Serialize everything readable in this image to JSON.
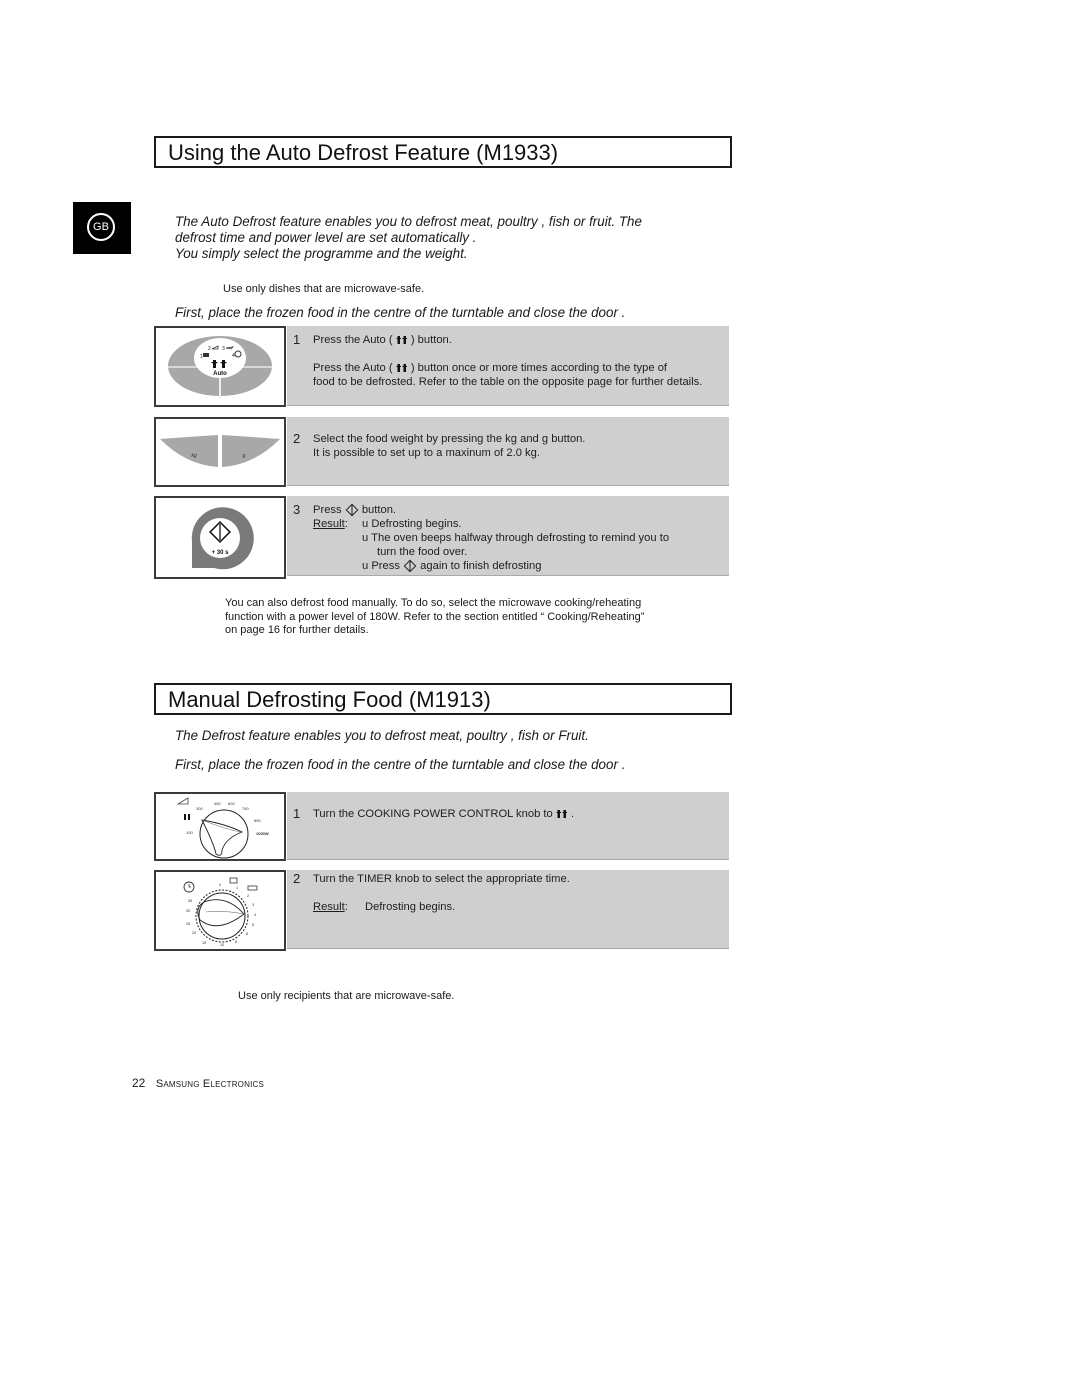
{
  "language_tab": {
    "label": "GB"
  },
  "section1": {
    "title": "Using the  Auto Defrost Feature (M1933)",
    "intro": [
      "The Auto Defrost feature enables you to defrost meat, poultry      , fish or fruit. The",
      "defrost time and power level are set automatically      .",
      "You simply select the programme and the weight."
    ],
    "note": "Use only dishes that are microwave-safe.",
    "instruction": "First, place the frozen food in the centre of the turntable and close the door        .",
    "steps": [
      {
        "number": "1",
        "line1_before": "Press the Auto (",
        "line1_after": ") button.",
        "line2_before": "Press the Auto (",
        "line2_after": ") button once or more times according to the type of",
        "line3": "food to be defrosted. Refer to the table on the opposite page for further details.",
        "image_label": "Auto",
        "image_numbers": [
          "1",
          "2",
          "3",
          "4"
        ]
      },
      {
        "number": "2",
        "line1": "Select the food weight by pressing the kg  and g button.",
        "line2": "It is possible to set up to a maxinum of 2.0 kg.",
        "image_labels": [
          "kg",
          "g"
        ]
      },
      {
        "number": "3",
        "line1_before": "Press",
        "line1_after": "button.",
        "result_label": "Result",
        "bullet": "u",
        "results": [
          "Defrosting begins.",
          "The oven beeps halfway through defrosting to remind you to",
          "turn the food over."
        ],
        "last_before": "Press",
        "last_after": "again to finish defrosting",
        "image_label": "+ 30 s"
      }
    ],
    "manual_note": [
      "You can also defrost food manually. To do so, select the microwave cooking/reheating",
      "function with a power level of 180W. Refer to the section entitled “ Cooking/Reheating”",
      "on page 16 for further details."
    ]
  },
  "section2": {
    "title": "Manual Defrosting Food (M1913)",
    "intro": "The Defrost feature enables you to defrost meat, poultry      , fish or Fruit.",
    "instruction": "First, place the frozen food in the centre of the turntable and close the door        .",
    "steps": [
      {
        "number": "1",
        "line1_before": "Turn the COOKING POWER CONTROL  knob to",
        "line1_after": ".",
        "dial_labels": [
          "100",
          "300",
          "450",
          "600",
          "750",
          "850",
          "1000W"
        ]
      },
      {
        "number": "2",
        "line1": "Turn the TIMER knob to select the appropriate time.",
        "result_label": "Result",
        "result_text": "Defrosting begins.",
        "dial_labels": [
          "0",
          "1",
          "2",
          "3",
          "4",
          "5",
          "6",
          "8",
          "10",
          "15",
          "20",
          "25",
          "30",
          "35"
        ]
      }
    ],
    "note": "Use only recipients that are microwave-safe."
  },
  "footer": {
    "page_number": "22",
    "brand": "Samsung Electronics"
  },
  "icons": {
    "auto_defrost": "defrost-icon",
    "start": "start-diamond-icon",
    "timer": "clock-icon",
    "power": "power-wedge-icon"
  }
}
